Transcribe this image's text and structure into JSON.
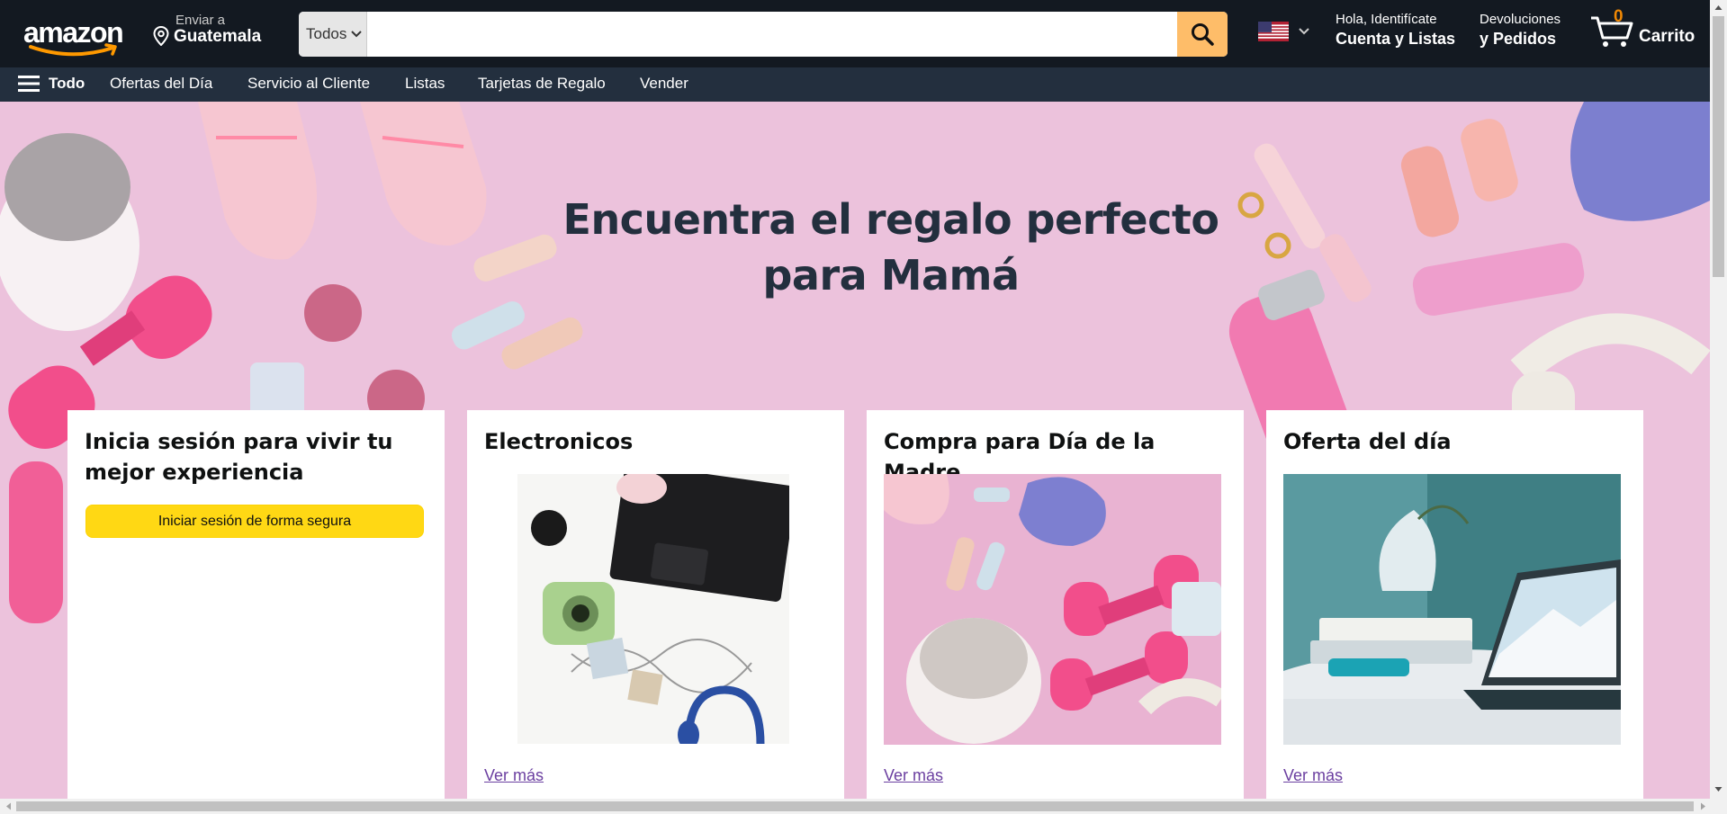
{
  "header": {
    "logo_text": "amazon",
    "deliver_line1": "Enviar a",
    "deliver_line2": "Guatemala",
    "search_department": "Todos",
    "search_placeholder": "",
    "account_line1": "Hola, Identifícate",
    "account_line2": "Cuenta y Listas",
    "orders_line1": "Devoluciones",
    "orders_line2": "y Pedidos",
    "cart_count": "0",
    "cart_label": "Carrito"
  },
  "nav": {
    "all_label": "Todo",
    "items": [
      "Ofertas del Día",
      "Servicio al Cliente",
      "Listas",
      "Tarjetas de Regalo",
      "Vender"
    ]
  },
  "hero": {
    "title": "Encuentra el regalo perfecto para Mamá"
  },
  "cards": [
    {
      "title": "Inicia sesión para vivir tu mejor experiencia",
      "button": "Iniciar sesión de forma segura"
    },
    {
      "title": "Electronicos",
      "link": "Ver más"
    },
    {
      "title": "Compra para Día de la Madre",
      "link": "Ver más"
    },
    {
      "title": "Oferta del día",
      "link": "Ver más"
    }
  ],
  "colors": {
    "header_bg": "#131921",
    "nav_bg": "#232f3e",
    "search_button": "#febd69",
    "hero_bg": "#ecc2dc",
    "signin_button": "#ffd814",
    "cart_count": "#f08804",
    "link": "#6b3fa0"
  },
  "icons": {
    "menu": "hamburger-icon",
    "location": "location-pin-icon",
    "search": "search-icon",
    "flag": "us-flag-icon",
    "cart": "cart-icon"
  }
}
